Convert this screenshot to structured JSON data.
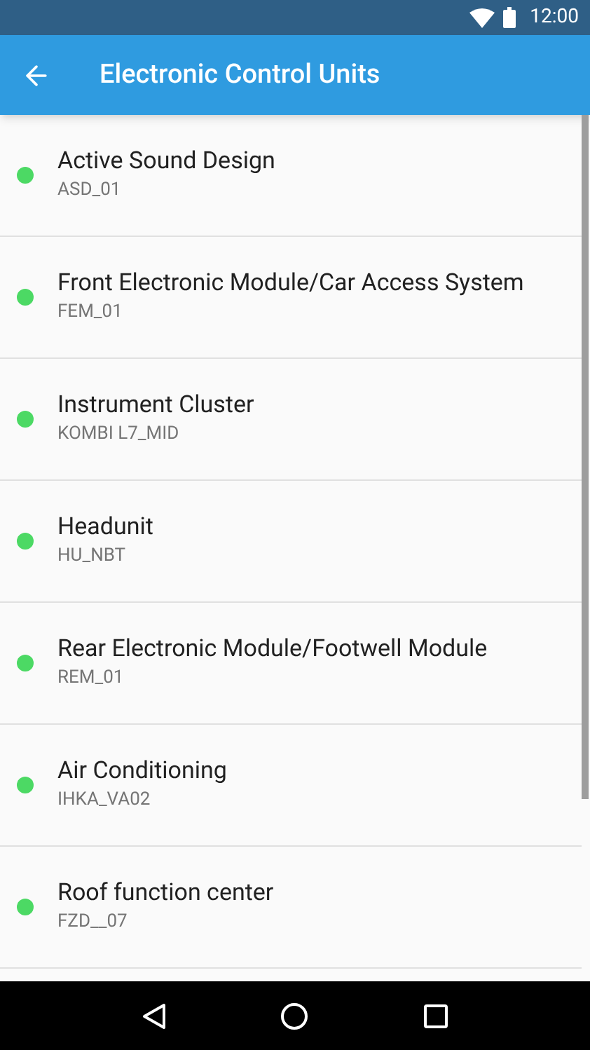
{
  "status_bar": {
    "time": "12:00"
  },
  "app_bar": {
    "title": "Electronic Control Units"
  },
  "units": [
    {
      "name": "Active Sound Design",
      "code": "ASD_01",
      "color": "#4cd964"
    },
    {
      "name": "Front Electronic Module/Car Access System",
      "code": "FEM_01",
      "color": "#4cd964"
    },
    {
      "name": "Instrument Cluster",
      "code": "KOMBI L7_MID",
      "color": "#4cd964"
    },
    {
      "name": "Headunit",
      "code": "HU_NBT",
      "color": "#4cd964"
    },
    {
      "name": "Rear Electronic Module/Footwell Module",
      "code": "REM_01",
      "color": "#4cd964"
    },
    {
      "name": "Air Conditioning",
      "code": "IHKA_VA02",
      "color": "#4cd964"
    },
    {
      "name": "Roof function center",
      "code": "FZD__07",
      "color": "#4cd964"
    }
  ]
}
